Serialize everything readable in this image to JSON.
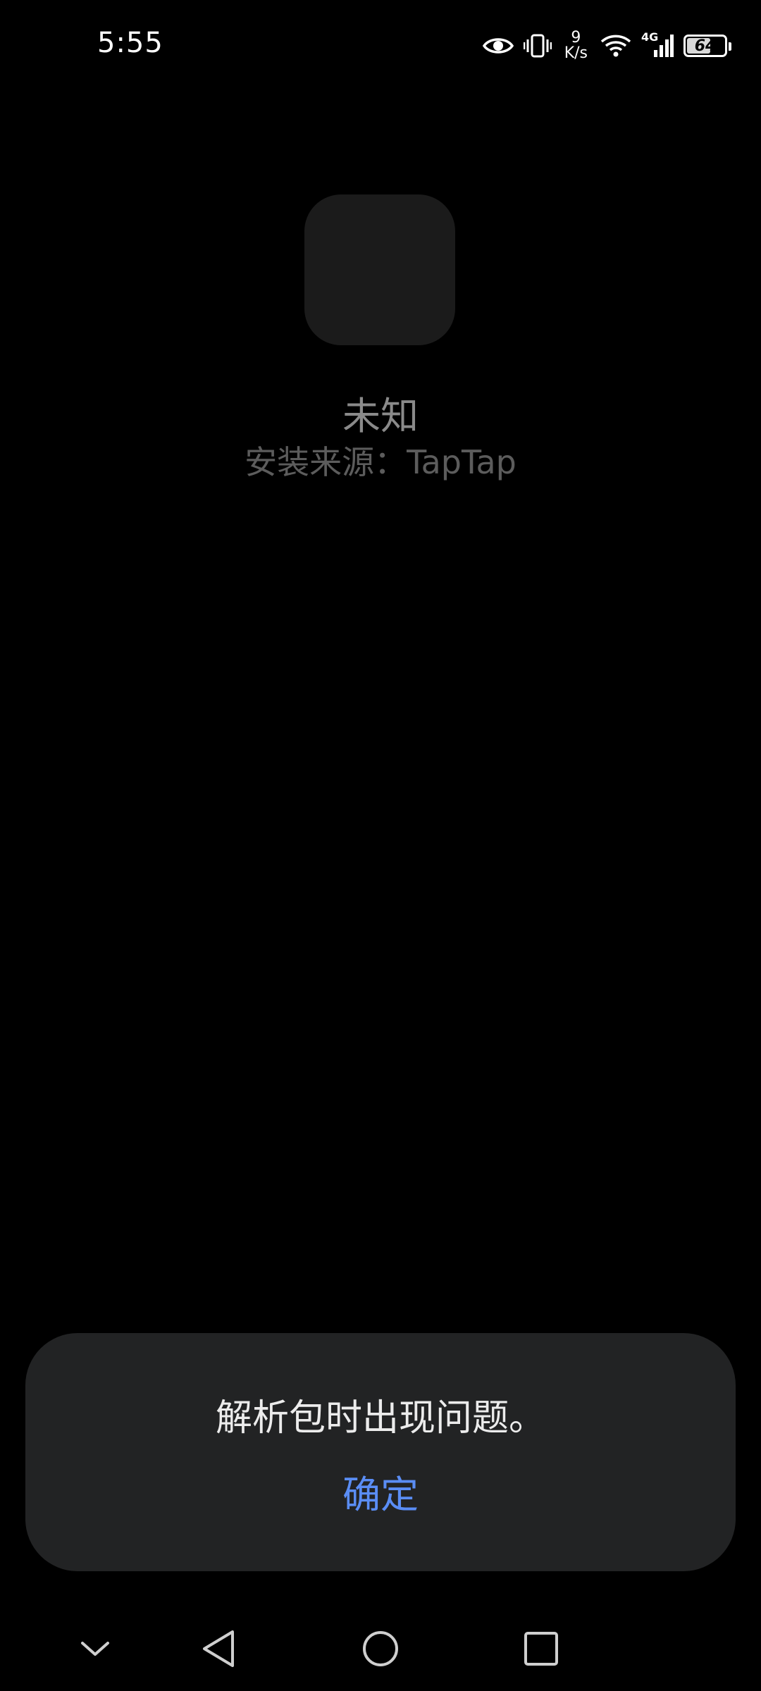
{
  "status_bar": {
    "time": "5:55",
    "net_speed_value": "9",
    "net_speed_unit": "K/s",
    "network_type": "4G",
    "battery_level": "64",
    "battery_fraction": 0.64,
    "icons": [
      "eye-icon",
      "vibrate-icon",
      "wifi-icon",
      "cellular-signal-icon",
      "battery-icon"
    ]
  },
  "app": {
    "name": "未知",
    "install_source": "安装来源：TapTap"
  },
  "dialog": {
    "message": "解析包时出现问题。",
    "confirm_label": "确定",
    "confirm_color": "#5a8df5"
  },
  "nav_bar": {
    "icons": [
      "chevron-down-icon",
      "back-icon",
      "home-icon",
      "recents-icon"
    ]
  }
}
